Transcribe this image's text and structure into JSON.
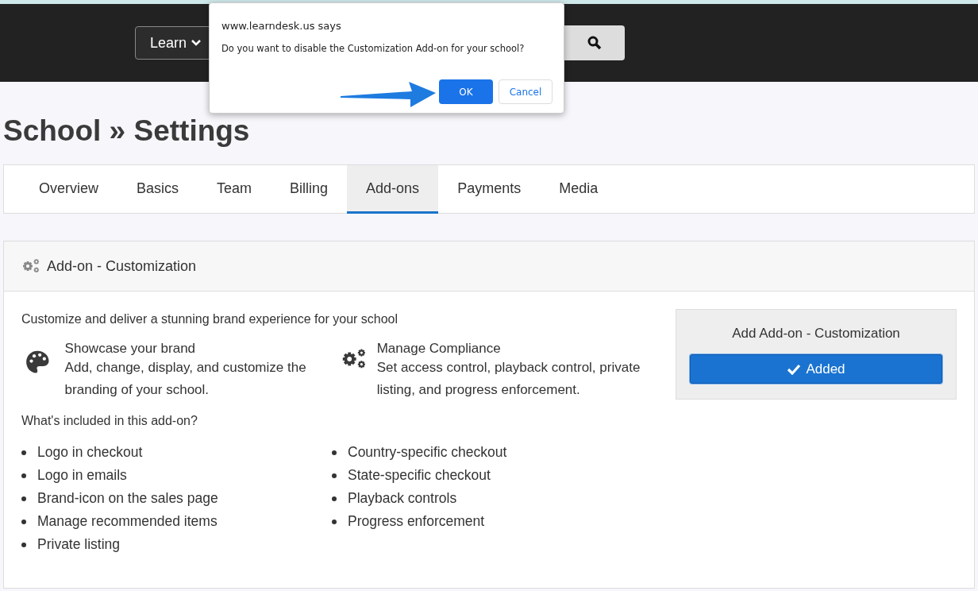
{
  "header": {
    "menu_label": "Learn"
  },
  "page_title": "School » Settings",
  "tabs": [
    {
      "label": "Overview",
      "selected": false
    },
    {
      "label": "Basics",
      "selected": false
    },
    {
      "label": "Team",
      "selected": false
    },
    {
      "label": "Billing",
      "selected": false
    },
    {
      "label": "Add-ons",
      "selected": true
    },
    {
      "label": "Payments",
      "selected": false
    },
    {
      "label": "Media",
      "selected": false
    }
  ],
  "panel": {
    "title": "Add-on - Customization",
    "intro": "Customize and deliver a stunning brand experience for your school",
    "features": [
      {
        "kind": "palette",
        "title": "Showcase your brand",
        "text": "Add, change, display, and customize the branding of your school."
      },
      {
        "kind": "gears",
        "title": "Manage Compliance",
        "text": "Set access control, playback control, private listing, and progress enforcement."
      }
    ],
    "included_heading": "What's included in this add-on?",
    "included_left": [
      "Logo in checkout",
      "Logo in emails",
      "Brand-icon on the sales page",
      "Manage recommended items",
      "Private listing"
    ],
    "included_right": [
      "Country-specific checkout",
      "State-specific checkout",
      "Playback controls",
      "Progress enforcement"
    ],
    "side_box": {
      "title": "Add Add-on - Customization",
      "button": "Added"
    }
  },
  "dialog": {
    "origin": "www.learndesk.us says",
    "message": "Do you want to disable the Customization Add-on for your school?",
    "ok": "OK",
    "cancel": "Cancel"
  }
}
